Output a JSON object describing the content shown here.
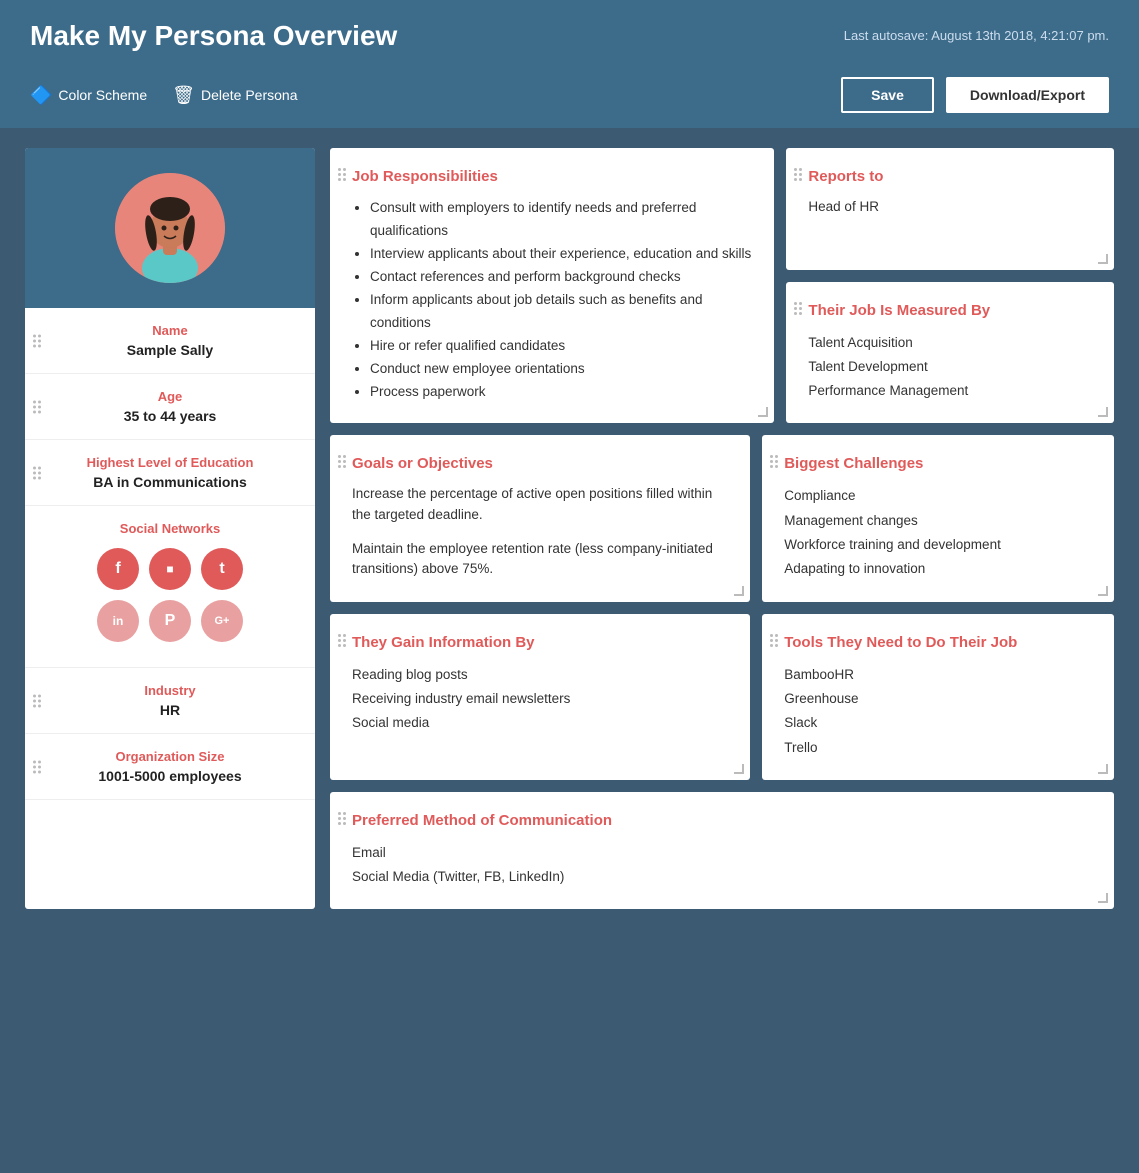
{
  "header": {
    "title": "Make My Persona Overview",
    "autosave": "Last autosave: August 13th 2018, 4:21:07 pm.",
    "color_scheme_label": "Color Scheme",
    "delete_persona_label": "Delete Persona",
    "save_label": "Save",
    "download_label": "Download/Export"
  },
  "sidebar": {
    "name_label": "Name",
    "name_value": "Sample Sally",
    "age_label": "Age",
    "age_value": "35 to 44 years",
    "education_label": "Highest Level of Education",
    "education_value": "BA in Communications",
    "social_label": "Social Networks",
    "social_icons": [
      "f",
      "IG",
      "t",
      "in",
      "P",
      "G+"
    ],
    "industry_label": "Industry",
    "industry_value": "HR",
    "org_size_label": "Organization Size",
    "org_size_value": "1001-5000 employees"
  },
  "cards": {
    "job_responsibilities": {
      "title": "Job Responsibilities",
      "items": [
        "Consult with employers to identify needs and preferred qualifications",
        "Interview applicants about their experience, education and skills",
        "Contact references and perform background checks",
        "Inform applicants about job details such as benefits and conditions",
        "Hire or refer qualified candidates",
        "Conduct new employee orientations",
        "Process paperwork"
      ]
    },
    "reports_to": {
      "title": "Reports to",
      "value": "Head of HR"
    },
    "job_measured_by": {
      "title": "Their Job Is Measured By",
      "items": [
        "Talent Acquisition",
        "Talent Development",
        "Performance Management"
      ]
    },
    "goals": {
      "title": "Goals or Objectives",
      "para1": "Increase the percentage of active open positions filled within the targeted deadline.",
      "para2": "Maintain the employee retention rate (less company-initiated transitions) above 75%."
    },
    "biggest_challenges": {
      "title": "Biggest Challenges",
      "items": [
        "Compliance",
        "Management changes",
        "Workforce training and development",
        "Adapating to innovation"
      ]
    },
    "gain_information": {
      "title": "They Gain Information By",
      "items": [
        "Reading blog posts",
        "Receiving industry email newsletters",
        "Social media"
      ]
    },
    "tools": {
      "title": "Tools They Need to Do Their Job",
      "items": [
        "BambooHR",
        "Greenhouse",
        "Slack",
        "Trello"
      ]
    },
    "communication": {
      "title": "Preferred Method of Communication",
      "items": [
        "Email",
        "Social Media (Twitter, FB, LinkedIn)"
      ]
    }
  }
}
